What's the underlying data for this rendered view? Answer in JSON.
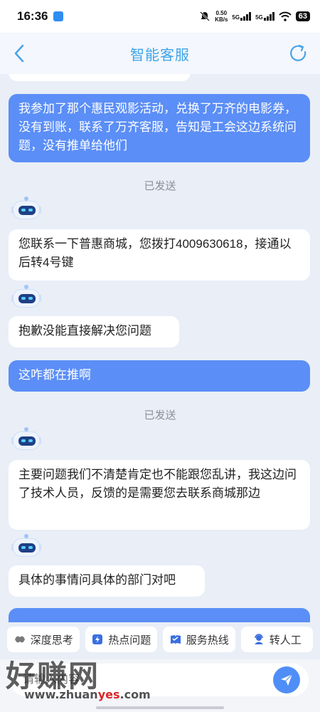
{
  "status_bar": {
    "time": "16:36",
    "net_speed": "0.50",
    "net_unit": "KB/s",
    "signal1": "5G",
    "signal2": "5G",
    "battery": "63"
  },
  "header": {
    "title": "智能客服"
  },
  "messages": [
    {
      "type": "user",
      "text": "我参加了那个惠民观影活动，兑换了万齐的电影券，没有到账，联系了万齐客服，告知是工会这边系统问题，没有推单给他们"
    },
    {
      "type": "status",
      "text": "已发送"
    },
    {
      "type": "bot",
      "text": "您联系一下普惠商城，您拨打4009630618，接通以后转4号键"
    },
    {
      "type": "bot",
      "text": "抱歉没能直接解决您问题"
    },
    {
      "type": "user",
      "text": "这咋都在推啊"
    },
    {
      "type": "status",
      "text": "已发送"
    },
    {
      "type": "bot",
      "text": "主要问题我们不清楚肯定也不能跟您乱讲，我这边问了技术人员，反馈的是需要您去联系商城那边"
    },
    {
      "type": "bot",
      "text": "具体的事情问具体的部门对吧"
    }
  ],
  "quick_actions": [
    {
      "label": "深度思考",
      "icon": "deep-think-icon"
    },
    {
      "label": "热点问题",
      "icon": "hot-topic-icon"
    },
    {
      "label": "服务热线",
      "icon": "hotline-icon"
    },
    {
      "label": "转人工",
      "icon": "agent-icon"
    }
  ],
  "input": {
    "placeholder": "请输入内容"
  },
  "watermark": {
    "brand": "好赚网",
    "url_prefix": "www.zhuan",
    "url_highlight": "yes",
    "url_suffix": ".com"
  },
  "colors": {
    "accent": "#5b8ef6",
    "title": "#3ea4e8",
    "background": "#e9eef7"
  }
}
